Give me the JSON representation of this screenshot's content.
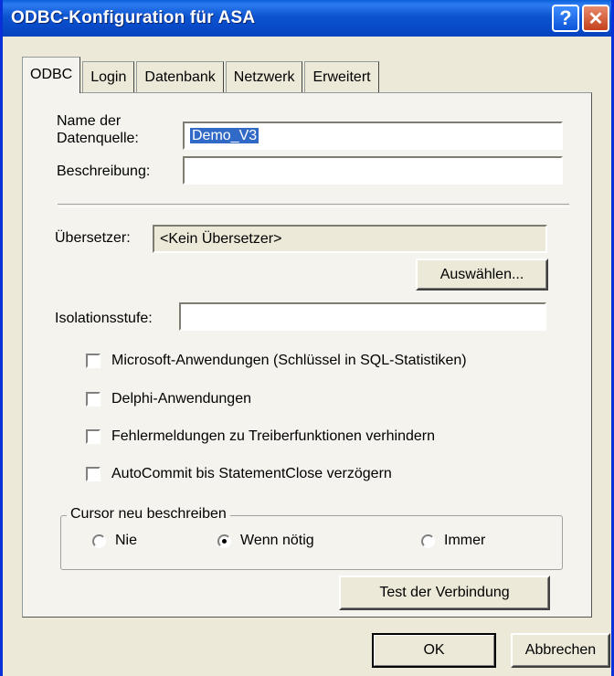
{
  "window": {
    "title": "ODBC-Konfiguration für ASA"
  },
  "titlebar": {
    "help_glyph": "?",
    "close_glyph": "✕"
  },
  "tabs": [
    {
      "label": "ODBC",
      "active": true
    },
    {
      "label": "Login",
      "active": false
    },
    {
      "label": "Datenbank",
      "active": false
    },
    {
      "label": "Netzwerk",
      "active": false
    },
    {
      "label": "Erweitert",
      "active": false
    }
  ],
  "form": {
    "datasource_label_line1": "Name der",
    "datasource_label_line2": "Datenquelle:",
    "datasource_value": "Demo_V3",
    "description_label": "Beschreibung:",
    "description_value": "",
    "translator_label": "Übersetzer:",
    "translator_value": "<Kein Übersetzer>",
    "choose_button": "Auswählen...",
    "isolation_label": "Isolationsstufe:",
    "isolation_value": ""
  },
  "checkboxes": [
    {
      "label": "Microsoft-Anwendungen (Schlüssel in SQL-Statistiken)",
      "checked": false
    },
    {
      "label": "Delphi-Anwendungen",
      "checked": false
    },
    {
      "label": "Fehlermeldungen zu Treiberfunktionen verhindern",
      "checked": false
    },
    {
      "label": "AutoCommit bis StatementClose verzögern",
      "checked": false
    }
  ],
  "cursor_group": {
    "label": "Cursor neu beschreiben",
    "options": [
      {
        "label": "Nie",
        "selected": false
      },
      {
        "label": "Wenn nötig",
        "selected": true
      },
      {
        "label": "Immer",
        "selected": false
      }
    ]
  },
  "test_button": "Test der Verbindung",
  "footer": {
    "ok": "OK",
    "cancel": "Abbrechen"
  }
}
